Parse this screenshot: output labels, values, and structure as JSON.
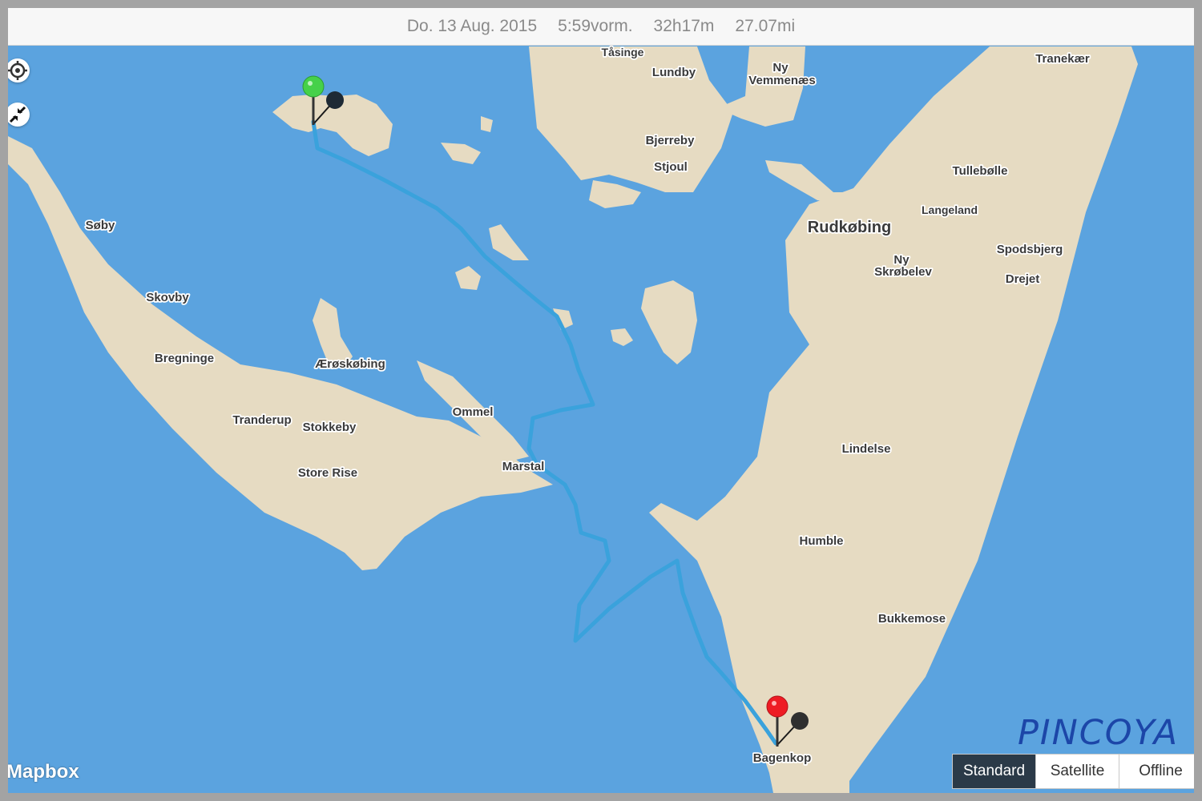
{
  "header": {
    "date": "Do. 13 Aug. 2015",
    "time": "5:59vorm.",
    "duration": "32h17m",
    "distance": "27.07mi"
  },
  "map": {
    "colors": {
      "water": "#5ba3df",
      "land": "#e6dbc2",
      "route": "#3aa2dc"
    },
    "places": {
      "tasinge": "Tåsinge",
      "lundby": "Lundby",
      "ny1": "Ny",
      "vemmenaes": "Vemmenæs",
      "bjerreby": "Bjerreby",
      "stjoul": "Stjoul",
      "tranekaer": "Tranekær",
      "tullebolle": "Tullebølle",
      "langeland": "Langeland",
      "rudkobing": "Rudkøbing",
      "spodsbjerg": "Spodsbjerg",
      "ny2": "Ny",
      "skrobelev": "Skrøbelev",
      "drejet": "Drejet",
      "soby": "Søby",
      "skovby": "Skovby",
      "bregninge": "Bregninge",
      "aeroskobing": "Ærøskøbing",
      "ommel": "Ommel",
      "tranderup": "Tranderup",
      "stokkeby": "Stokkeby",
      "store_rise": "Store Rise",
      "marstal": "Marstal",
      "lindelse": "Lindelse",
      "humble": "Humble",
      "bukkemose": "Bukkemose",
      "bagenkop": "Bagenkop"
    },
    "start_pin_icon": "green-pin",
    "end_pin_icon": "red-pin"
  },
  "controls": {
    "locate_icon": "crosshair-icon",
    "collapse_icon": "collapse-arrows-icon"
  },
  "attribution": "Mapbox",
  "watermark": "PINCOYA",
  "map_type": {
    "standard": "Standard",
    "satellite": "Satellite",
    "offline": "Offline",
    "selected": "Standard"
  }
}
